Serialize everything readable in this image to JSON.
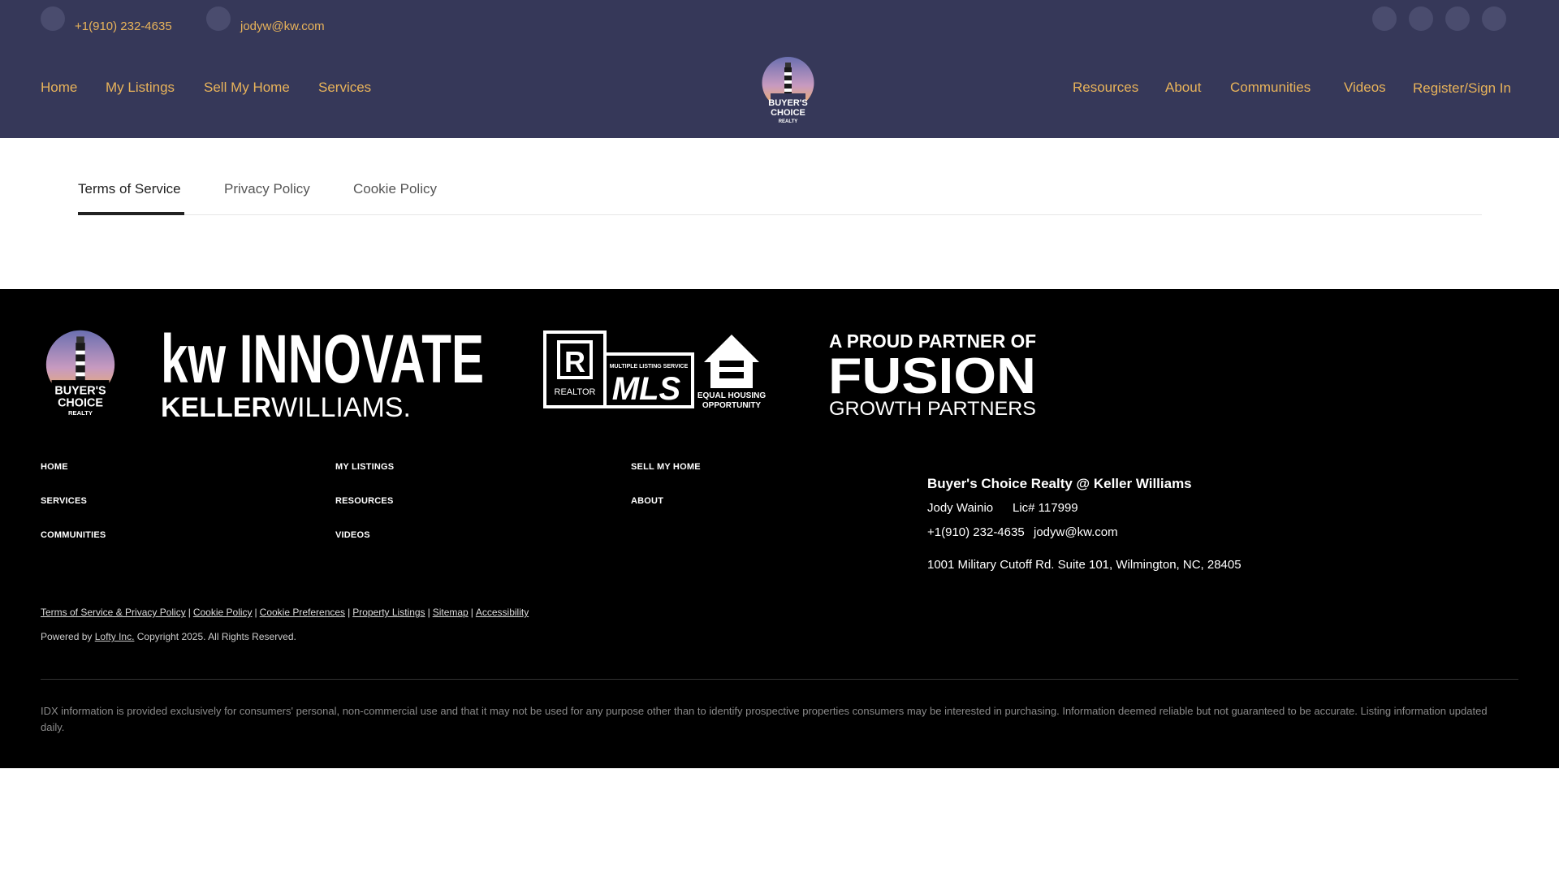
{
  "topbar": {
    "phone": "+1(910) 232-4635",
    "email": "jodyw@kw.com",
    "social_icons": [
      "social-icon-1",
      "social-icon-2",
      "social-icon-3",
      "social-icon-4"
    ]
  },
  "nav": {
    "left": [
      "Home",
      "My Listings",
      "Sell My Home",
      "Services"
    ],
    "right": [
      "Resources",
      "About",
      "Communities",
      "Videos"
    ],
    "register": "Register/Sign In"
  },
  "logo": {
    "line1": "BUYER'S",
    "line2": "CHOICE",
    "line3": "REALTY"
  },
  "tabs": [
    "Terms of Service",
    "Privacy Policy",
    "Cookie Policy"
  ],
  "footer": {
    "logos": {
      "kw_top": "kw INNOVATE",
      "kw_bottom_a": "KELLER",
      "kw_bottom_b": "WILLIAMS.",
      "realtor": "REALTOR",
      "mls_small": "MULTIPLE LISTING SERVICE",
      "mls": "MLS",
      "eho_line1": "EQUAL HOUSING",
      "eho_line2": "OPPORTUNITY",
      "fusion_top": "A PROUD PARTNER OF",
      "fusion_mid": "FUSION",
      "fusion_bottom": "GROWTH PARTNERS"
    },
    "links": {
      "col1": [
        "HOME",
        "SERVICES",
        "COMMUNITIES"
      ],
      "col2": [
        "MY LISTINGS",
        "RESOURCES",
        "VIDEOS"
      ],
      "col3": [
        "SELL MY HOME",
        "ABOUT"
      ]
    },
    "brand": {
      "title": "Buyer's Choice Realty @ Keller Williams",
      "agent": "Jody Wainio",
      "license": "Lic# 117999",
      "phone": "+1(910) 232-4635",
      "email": "jodyw@kw.com",
      "address": "1001 Military Cutoff Rd. Suite 101, Wilmington, NC, 28405"
    },
    "legal": [
      "Terms of Service & Privacy Policy",
      "Cookie Policy",
      "Cookie Preferences",
      "Property Listings",
      "Sitemap",
      "Accessibility"
    ],
    "powered_prefix": "Powered by",
    "powered_link": "Lofty Inc.",
    "powered_suffix": "Copyright 2025. All Rights Reserved.",
    "idx": "IDX information is provided exclusively for consumers' personal, non-commercial use and that it may not be used for any purpose other than to identify prospective properties consumers may be interested in purchasing. Information deemed reliable but not guaranteed to be accurate. Listing information updated daily."
  },
  "colors": {
    "header_bg": "#363859",
    "accent": "#e8b35a",
    "footer_bg": "#000000"
  }
}
